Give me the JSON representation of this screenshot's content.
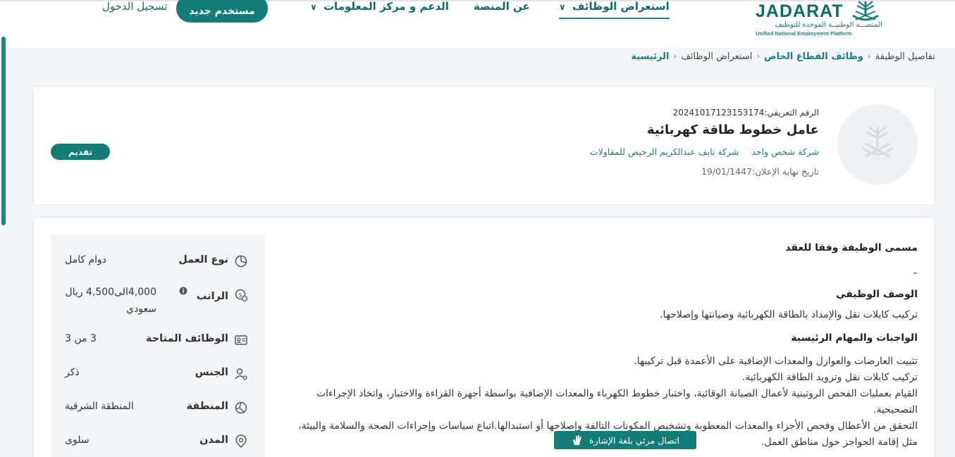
{
  "header": {
    "logo_word": "JADARAT",
    "logo_arabic": "المنصـــة الوطنيــة الموحدة للتوظيف",
    "logo_english": "Unified National Employment Platform",
    "nav": [
      {
        "label": "استعراض الوظائف",
        "active": true
      },
      {
        "label": "عن المنصة",
        "active": false
      },
      {
        "label": "الدعم و مركز المعلومات",
        "active": false
      }
    ],
    "new_user_label": "مستخدم جديد",
    "login_label": "تسجيل الدخول"
  },
  "breadcrumb": {
    "home": "الرئيسية",
    "browse": "استعراض الوظائف",
    "private": "وظائف القطاع الخاص",
    "current": "تفاصيل الوظيفة",
    "separator": "‹"
  },
  "job": {
    "reference": "الرقم التعريفي:20241017123153174",
    "title": "عامل خطوط طاقة كهربائية",
    "company": "شركة نايف عبدالكريم الرخيص للمقاولات",
    "company_type": "شركة شخص واحد",
    "deadline": "تاريخ نهاية الإعلان:19/01/1447",
    "apply_label": "تقديم"
  },
  "description": {
    "contract_title_heading": "مسمى الوظيفة وفقا للعقد",
    "contract_title_value": "–",
    "job_desc_heading": "الوصف الوظيفي",
    "job_desc_text": "تركيب كابلات نقل والإمداد بالطاقة الكهربائية وصيانتها وإصلاحها.",
    "duties_heading": "الواجبات والمهام الرئيسية",
    "duties": [
      "تثبيت العارضات والعوازل والمعدات الإضافية على الأعمدة قبل تركيبها.",
      "تركيب كابلات نقل وتزويد الطاقة الكهربائية.",
      "القيام بعمليات الفحص الروتينية لأعمال الصيانة الوقائية، واختبار خطوط الكهرباء والمعدات الإضافية بواسطة أجهزة القراءة والاختبار، واتخاذ الإجراءات التصحيحية.",
      "التحقق من الأعطال وفحص الأجزاء والمعدات المعطوبة وتشخيص المكونات التالفة وإصلاحها أو استبدالها.اتباع سياسات وإجراءات الصحة والسلامة والبيئة، مثل إقامة الحواجز حول مناطق العمل."
    ]
  },
  "attributes": [
    {
      "label": "نوع العمل",
      "value": "دوام كامل",
      "icon": "pie-chart-icon"
    },
    {
      "label": "الراتب",
      "value": "4,000الى4,500 ريال سعودي",
      "icon": "money-icon"
    },
    {
      "label": "الوظائف المتاحة",
      "value": "3 من 3",
      "icon": "id-card-icon"
    },
    {
      "label": "الجنس",
      "value": "ذكر",
      "icon": "user-gender-icon"
    },
    {
      "label": "المنطقة",
      "value": "المنطقة الشرقية",
      "icon": "map-icon"
    },
    {
      "label": "المدن",
      "value": "سلوى",
      "icon": "location-pin-icon"
    }
  ],
  "sign_language_label": "اتصال مرئي بلغة الإشارة",
  "colors": {
    "primary": "#147c77",
    "link": "#1a7f7a",
    "background": "#f3f6f8"
  }
}
